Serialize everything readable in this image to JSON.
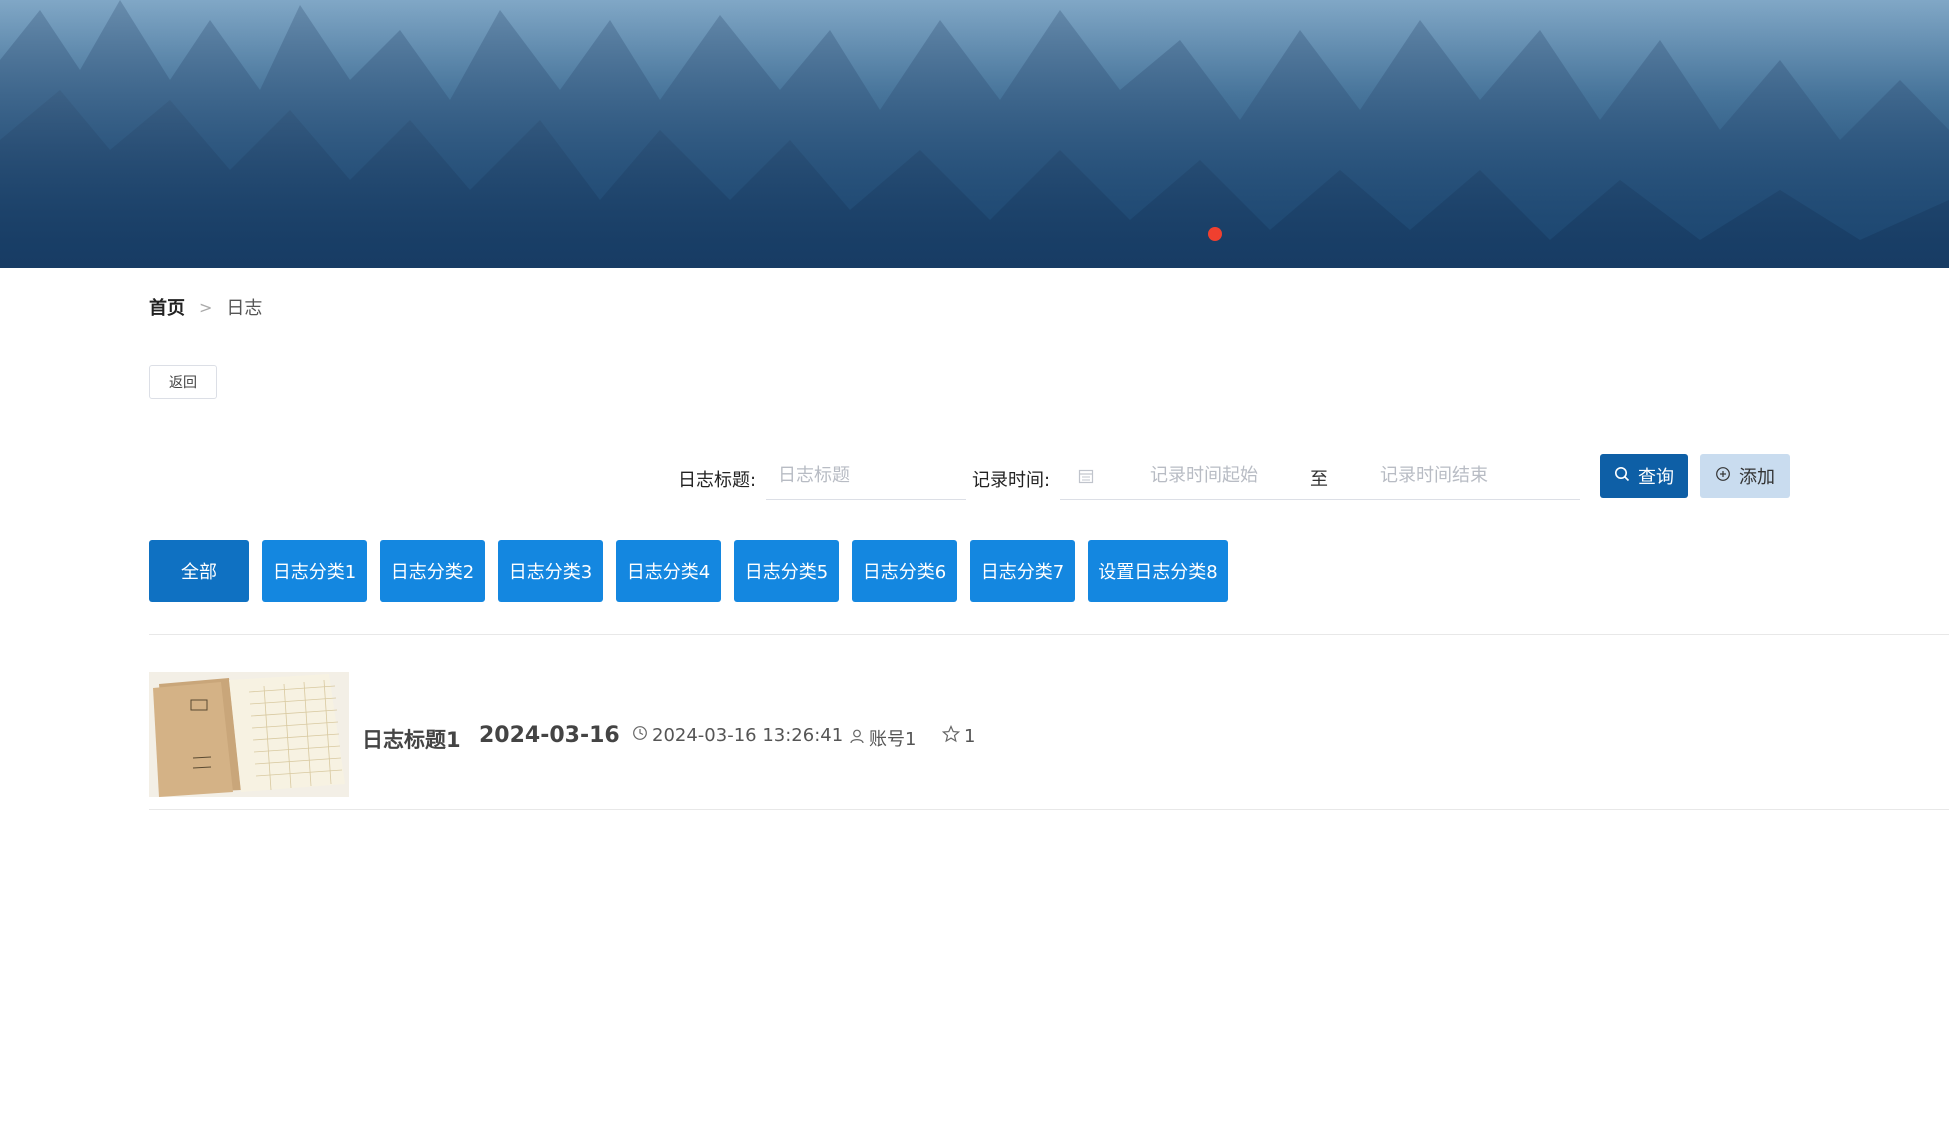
{
  "breadcrumb": {
    "home": "首页",
    "separator": ">",
    "current": "日志"
  },
  "back_button": {
    "label": "返回"
  },
  "search": {
    "title_label": "日志标题:",
    "title_placeholder": "日志标题",
    "time_label": "记录时间:",
    "time_start_placeholder": "记录时间起始",
    "time_range_sep": "至",
    "time_end_placeholder": "记录时间结束",
    "query_label": "查询",
    "add_label": "添加"
  },
  "categories": [
    {
      "label": "全部",
      "active": true
    },
    {
      "label": "日志分类1"
    },
    {
      "label": "日志分类2"
    },
    {
      "label": "日志分类3"
    },
    {
      "label": "日志分类4"
    },
    {
      "label": "日志分类5"
    },
    {
      "label": "日志分类6"
    },
    {
      "label": "日志分类7"
    },
    {
      "label": "设置日志分类8"
    }
  ],
  "items": [
    {
      "title": "日志标题1",
      "date": "2024-03-16",
      "timestamp": "2024-03-16 13:26:41",
      "account": "账号1",
      "stars": "1"
    }
  ],
  "colors": {
    "primary": "#1487e0",
    "active": "#0f71c2",
    "query": "#0e5fa6",
    "add_bg": "#c9dcef",
    "carousel_dot": "#f0402f"
  },
  "icons": {
    "query": "search-icon",
    "add": "plus-circle-icon",
    "calendar": "calendar-icon",
    "time": "clock-icon",
    "account": "user-icon",
    "stars": "star-icon"
  }
}
